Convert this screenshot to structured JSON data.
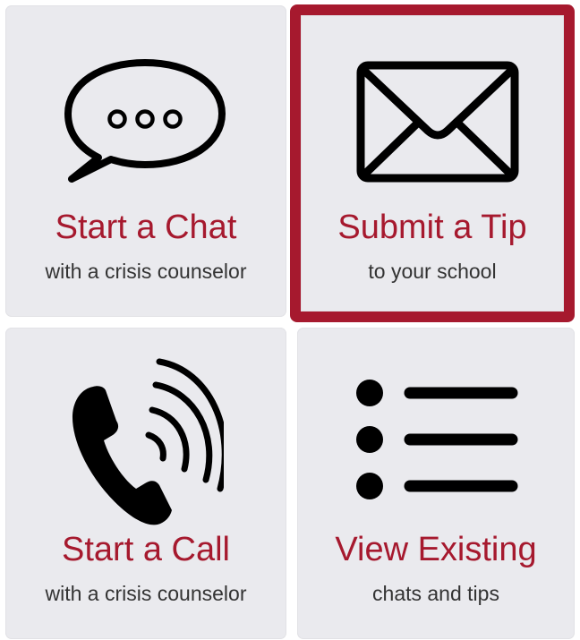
{
  "tiles": {
    "chat": {
      "title": "Start a Chat",
      "subtitle": "with a crisis counselor",
      "icon": "chat-bubble-icon"
    },
    "tip": {
      "title": "Submit a Tip",
      "subtitle": "to your school",
      "icon": "envelope-icon",
      "selected": true
    },
    "call": {
      "title": "Start a Call",
      "subtitle": "with a crisis counselor",
      "icon": "phone-icon"
    },
    "view": {
      "title": "View Existing",
      "subtitle": "chats and tips",
      "icon": "list-icon"
    }
  },
  "colors": {
    "accent": "#a6192e",
    "tile_background": "#eaeaee",
    "subtitle_text": "#333333",
    "icon": "#000000"
  }
}
